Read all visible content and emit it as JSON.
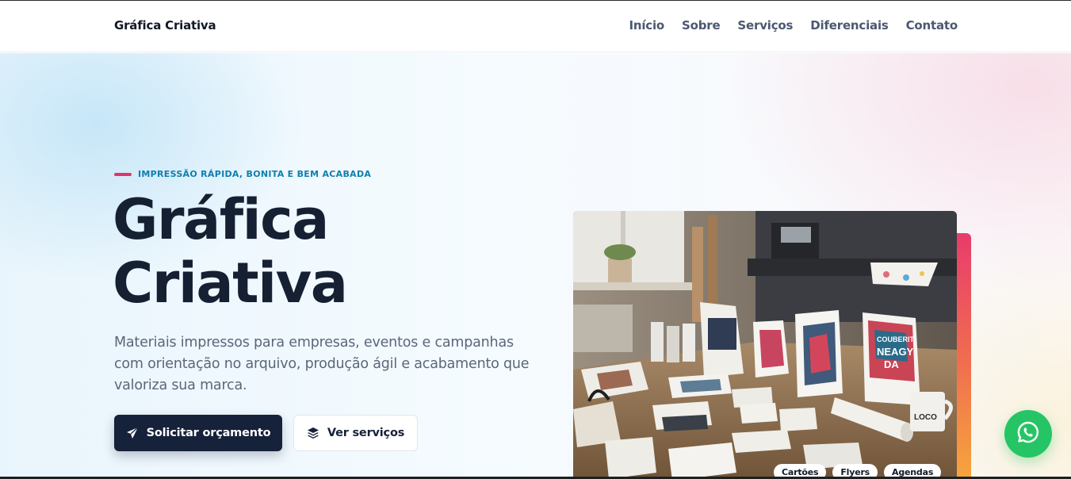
{
  "header": {
    "brand": "Gráfica Criativa",
    "nav": [
      "Início",
      "Sobre",
      "Serviços",
      "Diferenciais",
      "Contato"
    ]
  },
  "hero": {
    "eyebrow": "IMPRESSÃO RÁPIDA, BONITA E BEM ACABADA",
    "title_line1": "Gráfica",
    "title_line2": "Criativa",
    "lead": "Materiais impressos para empresas, eventos e campanhas com orientação no arquivo, produção ágil e acabamento que valoriza sua marca.",
    "primary_button": "Solicitar orçamento",
    "secondary_button": "Ver serviços",
    "image_texts": {
      "calendar_line1": "COUBERIT",
      "calendar_line2": "NEAGY",
      "calendar_line3": "DA",
      "mug": "LOCO"
    },
    "tags": [
      "Cartões",
      "Flyers",
      "Agendas"
    ]
  },
  "icons": {
    "primary_button_icon": "paper-plane-icon",
    "secondary_button_icon": "layers-icon",
    "floating_button_icon": "whatsapp-icon"
  },
  "colors": {
    "dark": "#16213a",
    "accent_pink": "#e0356b",
    "eyebrow_blue": "#0f7fae",
    "whatsapp": "#25c565"
  }
}
